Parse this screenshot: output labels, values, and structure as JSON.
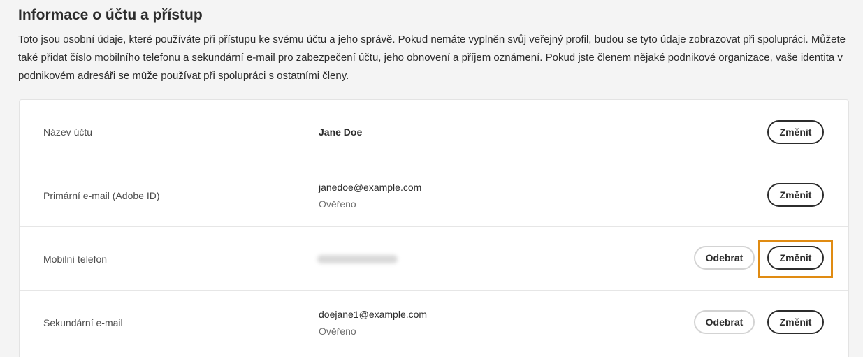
{
  "section": {
    "title": "Informace o účtu a přístup",
    "description": "Toto jsou osobní údaje, které používáte při přístupu ke svému účtu a jeho správě. Pokud nemáte vyplněn svůj veřejný profil, budou se tyto údaje zobrazovat při spolupráci. Můžete také přidat číslo mobilního telefonu a sekundární e-mail pro zabezpečení účtu, jeho obnovení a příjem oznámení. Pokud jste členem nějaké podnikové organizace, vaše identita v podnikovém adresáři se může používat při spolupráci s ostatními členy."
  },
  "rows": [
    {
      "label": "Název účtu",
      "value": "Jane Doe",
      "change_label": "Změnit"
    },
    {
      "label": "Primární e-mail (Adobe ID)",
      "value": "janedoe@example.com",
      "status": "Ověřeno",
      "change_label": "Změnit"
    },
    {
      "label": "Mobilní telefon",
      "remove_label": "Odebrat",
      "change_label": "Změnit"
    },
    {
      "label": "Sekundární e-mail",
      "value": "doejane1@example.com",
      "status": "Ověřeno",
      "remove_label": "Odebrat",
      "change_label": "Změnit"
    }
  ],
  "colors": {
    "highlight": "#e08b12",
    "background": "#f4f4f4",
    "card": "#ffffff"
  }
}
